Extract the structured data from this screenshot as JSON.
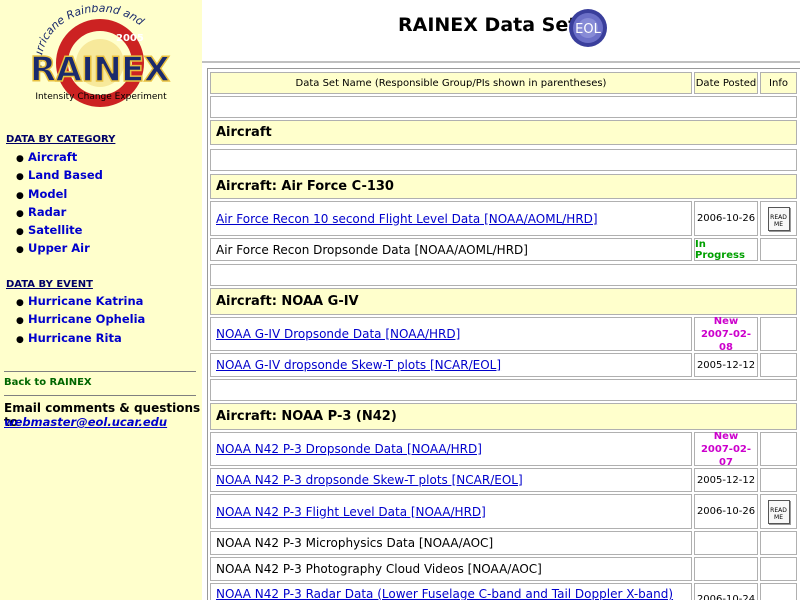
{
  "logo": {
    "arc_text": "Hurricane Rainband and",
    "year": "2005",
    "name": "RAINEX",
    "subtitle": "Intensity Change Experiment",
    "colors": {
      "red": "#cc2222",
      "navy": "#1a2a6c",
      "gold": "#e8c040"
    }
  },
  "sidebar": {
    "category_heading": "DATA BY CATEGORY",
    "categories": [
      "Aircraft",
      "Land Based",
      "Model",
      "Radar",
      "Satellite",
      "Upper Air"
    ],
    "event_heading": "DATA BY EVENT",
    "events": [
      "Hurricane Katrina",
      "Hurricane Ophelia",
      "Hurricane Rita"
    ],
    "back_link": "Back to RAINEX",
    "email_text": "Email comments & questions to",
    "email_link": "webmaster@eol.ucar.edu"
  },
  "header": {
    "title": "RAINEX Data Sets",
    "eol_logo_text": "EOL"
  },
  "table": {
    "columns": [
      "Data Set Name (Responsible Group/PIs shown in parentheses)",
      "Date Posted",
      "Info"
    ],
    "sections": {
      "s1": "Aircraft",
      "s2": "Aircraft: Air Force C-130",
      "s3": "Aircraft: NOAA G-IV",
      "s4": "Aircraft: NOAA P-3 (N42)"
    },
    "rows": {
      "r1": {
        "name": "Air Force Recon 10 second Flight Level Data [NOAA/AOML/HRD]",
        "date": "2006-10-26"
      },
      "r2": {
        "name": "Air Force Recon Dropsonde Data [NOAA/AOML/HRD]",
        "status": "In Progress"
      },
      "r3": {
        "name": "NOAA G-IV Dropsonde Data [NOAA/HRD]",
        "new": "New",
        "date": "2007-02-08"
      },
      "r4": {
        "name": "NOAA G-IV dropsonde Skew-T plots [NCAR/EOL]",
        "date": "2005-12-12"
      },
      "r5": {
        "name": "NOAA N42 P-3 Dropsonde Data [NOAA/HRD]",
        "new": "New",
        "date": "2007-02-07"
      },
      "r6": {
        "name": "NOAA N42 P-3 dropsonde Skew-T plots [NCAR/EOL]",
        "date": "2005-12-12"
      },
      "r7": {
        "name": "NOAA N42 P-3 Flight Level Data [NOAA/HRD]",
        "date": "2006-10-26"
      },
      "r8": {
        "name": "NOAA N42 P-3 Microphysics Data [NOAA/AOC]"
      },
      "r9": {
        "name": "NOAA N42 P-3 Photography Cloud Videos [NOAA/AOC]"
      },
      "r10": {
        "name": "NOAA N42 P-3 Radar Data (Lower Fuselage C-band and Tail Doppler X-band)",
        "date": "2006-10-24"
      }
    },
    "readme_label": "READ ME"
  }
}
